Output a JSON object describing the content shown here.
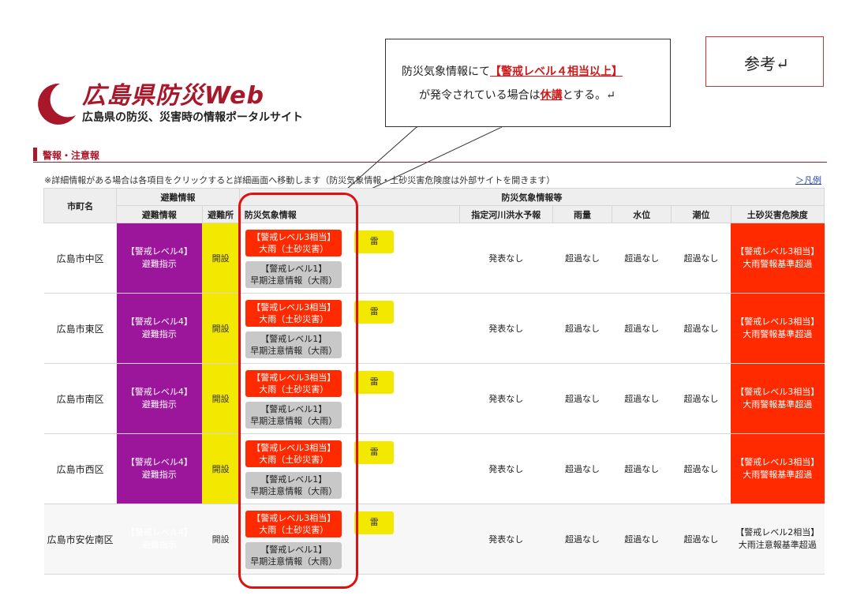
{
  "logo": {
    "title": "広島県防災Web",
    "subtitle": "広島県の防災、災害時の情報ポータルサイト",
    "icon": "crescent-logo-icon",
    "brand_color": "#a8182a"
  },
  "callout": {
    "line1_pre": "防災気象情報にて",
    "line1_red": "【警戒レベル４相当以上】",
    "line2_pre": "が発令されている場合は",
    "line2_red": "休講",
    "line2_post": "とする。↵"
  },
  "reference": {
    "label": "参考↵"
  },
  "section": {
    "title": "警報・注意報"
  },
  "note": "※詳細情報がある場合は各項目をクリックすると詳細画面へ移動します（防災気象情報・土砂災害危険度は外部サイトを開きます）",
  "legend_link": "＞凡例",
  "headers": {
    "city": "市町名",
    "evac_group": "避難情報",
    "weather_group": "防災気象情報等",
    "evac_info": "避難情報",
    "shelter": "避難所",
    "weather_info": "防災気象情報",
    "river": "指定河川洪水予報",
    "rain": "雨量",
    "water": "水位",
    "tide": "潮位",
    "landslide": "土砂災害危険度"
  },
  "rows": [
    {
      "city": "広島市中区",
      "evac_1": "【警戒レベル4】",
      "evac_2": "避難指示",
      "shelter": "開設",
      "wx_red_1": "【警戒レベル3相当】",
      "wx_red_2": "大雨（土砂災害）",
      "wx_gray_1": "【警戒レベル1】",
      "wx_gray_2": "早期注意情報（大雨）",
      "thunder": "雷",
      "river": "発表なし",
      "rain": "超過なし",
      "water": "超過なし",
      "tide": "超過なし",
      "land_1": "【警戒レベル3相当】",
      "land_2": "大雨警報基準超過",
      "land_level": "red"
    },
    {
      "city": "広島市東区",
      "evac_1": "【警戒レベル4】",
      "evac_2": "避難指示",
      "shelter": "開設",
      "wx_red_1": "【警戒レベル3相当】",
      "wx_red_2": "大雨（土砂災害）",
      "wx_gray_1": "【警戒レベル1】",
      "wx_gray_2": "早期注意情報（大雨）",
      "thunder": "雷",
      "river": "発表なし",
      "rain": "超過なし",
      "water": "超過なし",
      "tide": "超過なし",
      "land_1": "【警戒レベル3相当】",
      "land_2": "大雨警報基準超過",
      "land_level": "red"
    },
    {
      "city": "広島市南区",
      "evac_1": "【警戒レベル4】",
      "evac_2": "避難指示",
      "shelter": "開設",
      "wx_red_1": "【警戒レベル3相当】",
      "wx_red_2": "大雨（土砂災害）",
      "wx_gray_1": "【警戒レベル1】",
      "wx_gray_2": "早期注意情報（大雨）",
      "thunder": "雷",
      "river": "発表なし",
      "rain": "超過なし",
      "water": "超過なし",
      "tide": "超過なし",
      "land_1": "【警戒レベル3相当】",
      "land_2": "大雨警報基準超過",
      "land_level": "red"
    },
    {
      "city": "広島市西区",
      "evac_1": "【警戒レベル4】",
      "evac_2": "避難指示",
      "shelter": "開設",
      "wx_red_1": "【警戒レベル3相当】",
      "wx_red_2": "大雨（土砂災害）",
      "wx_gray_1": "【警戒レベル1】",
      "wx_gray_2": "早期注意情報（大雨）",
      "thunder": "雷",
      "river": "発表なし",
      "rain": "超過なし",
      "water": "超過なし",
      "tide": "超過なし",
      "land_1": "【警戒レベル3相当】",
      "land_2": "大雨警報基準超過",
      "land_level": "red"
    },
    {
      "city": "広島市安佐南区",
      "evac_1": "【警戒レベル4】",
      "evac_2": "避難指示",
      "shelter": "開設",
      "wx_red_1": "【警戒レベル3相当】",
      "wx_red_2": "大雨（土砂災害）",
      "wx_gray_1": "【警戒レベル1】",
      "wx_gray_2": "早期注意情報（大雨）",
      "thunder": "雷",
      "river": "発表なし",
      "rain": "超過なし",
      "water": "超過なし",
      "tide": "超過なし",
      "land_1": "【警戒レベル2相当】",
      "land_2": "大雨注意報基準超過",
      "land_level": "yellow"
    }
  ],
  "colors": {
    "purple": "#9c169c",
    "red": "#ff2a00",
    "yellow": "#f3e800",
    "gray": "#c8c8c8",
    "highlight": "#e01010"
  }
}
